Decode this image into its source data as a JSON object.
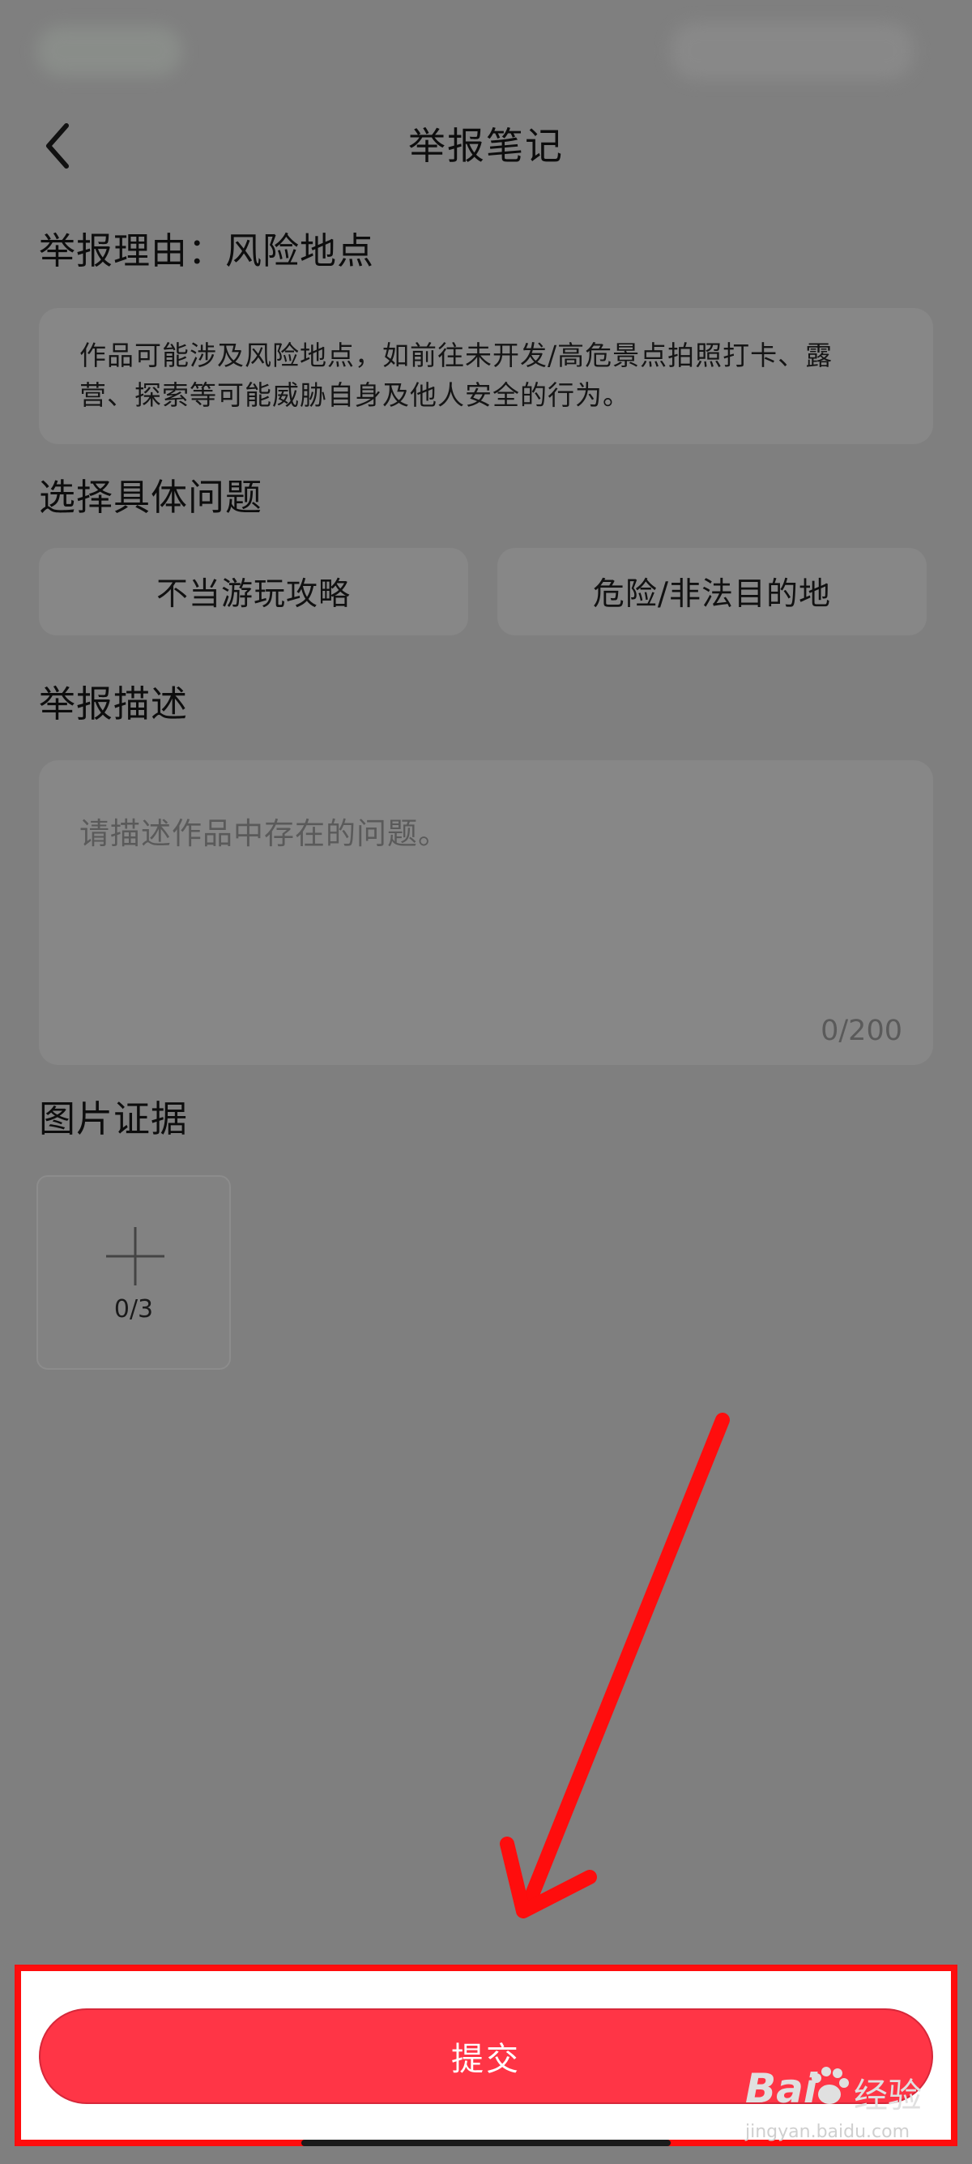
{
  "header": {
    "title": "举报笔记",
    "back_icon": "chevron-left-icon"
  },
  "reason": {
    "label": "举报理由：风险地点",
    "description_line1": "作品可能涉及风险地点，如前往未开发/高危景点拍照打卡、露",
    "description_line2": "营、探索等可能威胁自身及他人安全的行为。"
  },
  "issues": {
    "label": "选择具体问题",
    "options": [
      "不当游玩攻略",
      "危险/非法目的地"
    ]
  },
  "description": {
    "label": "举报描述",
    "placeholder": "请描述作品中存在的问题。",
    "counter": "0/200"
  },
  "evidence": {
    "label": "图片证据",
    "count": "0/3",
    "add_icon": "plus-icon"
  },
  "submit": {
    "label": "提交"
  },
  "watermark": {
    "brand": "Bai",
    "product": "经验",
    "url": "jingyan.baidu.com"
  },
  "colors": {
    "overlay": "#7f7f7f",
    "submit_button": "#ff3546",
    "annotation_red": "#ff0d0d"
  }
}
